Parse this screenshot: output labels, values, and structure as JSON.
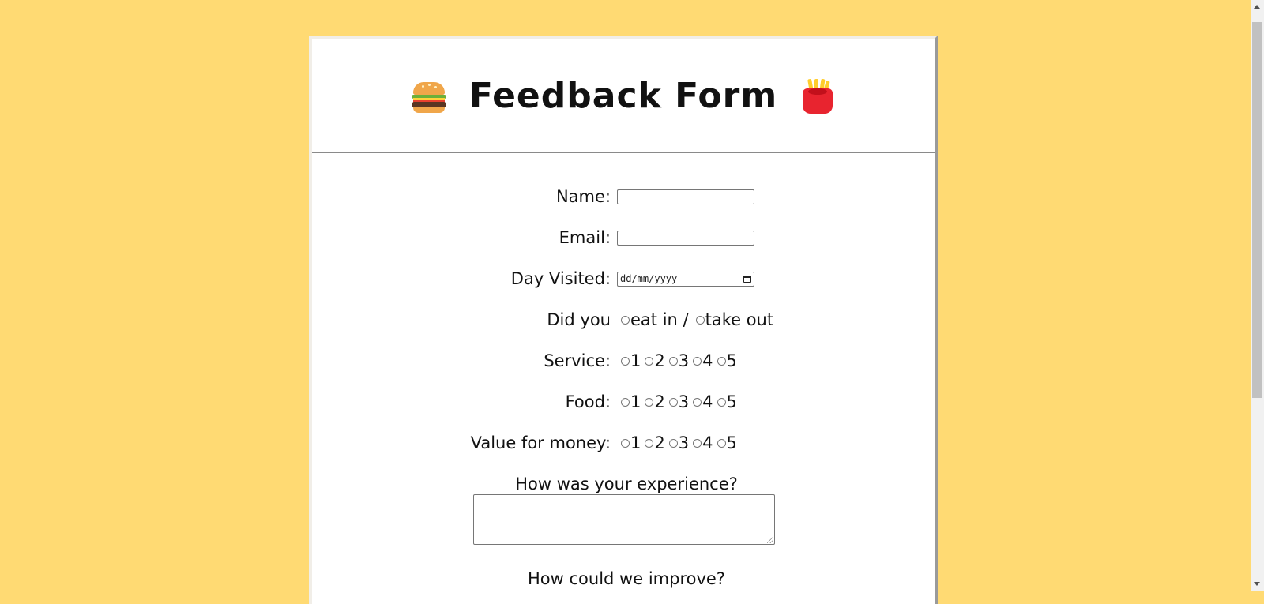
{
  "header": {
    "title": "Feedback Form",
    "left_icon": "burger-icon",
    "right_icon": "fries-icon"
  },
  "form": {
    "name_label": "Name:",
    "email_label": "Email:",
    "day_label": "Day Visited:",
    "day_placeholder": "dd/mm/yyyy",
    "dine_label": "Did you",
    "dine_options": [
      "eat in /",
      "take out"
    ],
    "service_label": "Service:",
    "food_label": "Food:",
    "value_label": "Value for money:",
    "ratings": [
      "1",
      "2",
      "3",
      "4",
      "5"
    ],
    "experience_label": "How was your experience?",
    "improve_label": "How could we improve?"
  },
  "colors": {
    "background": "#ffda73",
    "card": "#ffffff"
  }
}
